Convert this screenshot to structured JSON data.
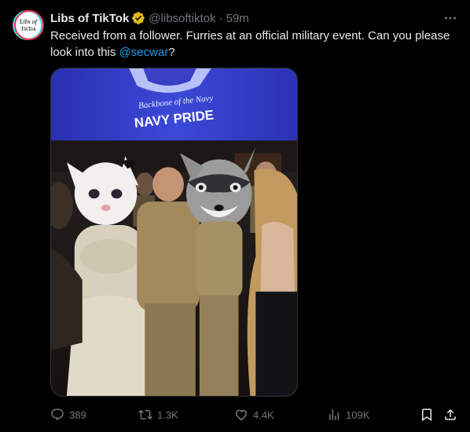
{
  "author": {
    "name": "Libs of TikTok",
    "handle": "@libsoftiktok",
    "separator": "·",
    "time": "59m",
    "avatar_text": "Libs of TikTok"
  },
  "tweet": {
    "text_before": "Received from a follower. Furries at an official military event. Can you please look into this ",
    "mention": "@secwar",
    "text_after": "?"
  },
  "media": {
    "banner_top": "Backbone of the Navy",
    "banner_main": "NAVY PRIDE"
  },
  "actions": {
    "replies": "389",
    "reposts": "1.3K",
    "likes": "4.4K",
    "views": "109K"
  },
  "colors": {
    "background": "#000000",
    "text": "#e7e9ea",
    "muted": "#71767b",
    "link": "#1d9bf0",
    "verified": "#e2b719"
  },
  "icons": {
    "verified": "verified-badge-icon",
    "more": "more-dots-icon",
    "reply": "reply-icon",
    "repost": "repost-icon",
    "like": "heart-icon",
    "views": "views-chart-icon",
    "bookmark": "bookmark-icon",
    "share": "share-icon"
  }
}
